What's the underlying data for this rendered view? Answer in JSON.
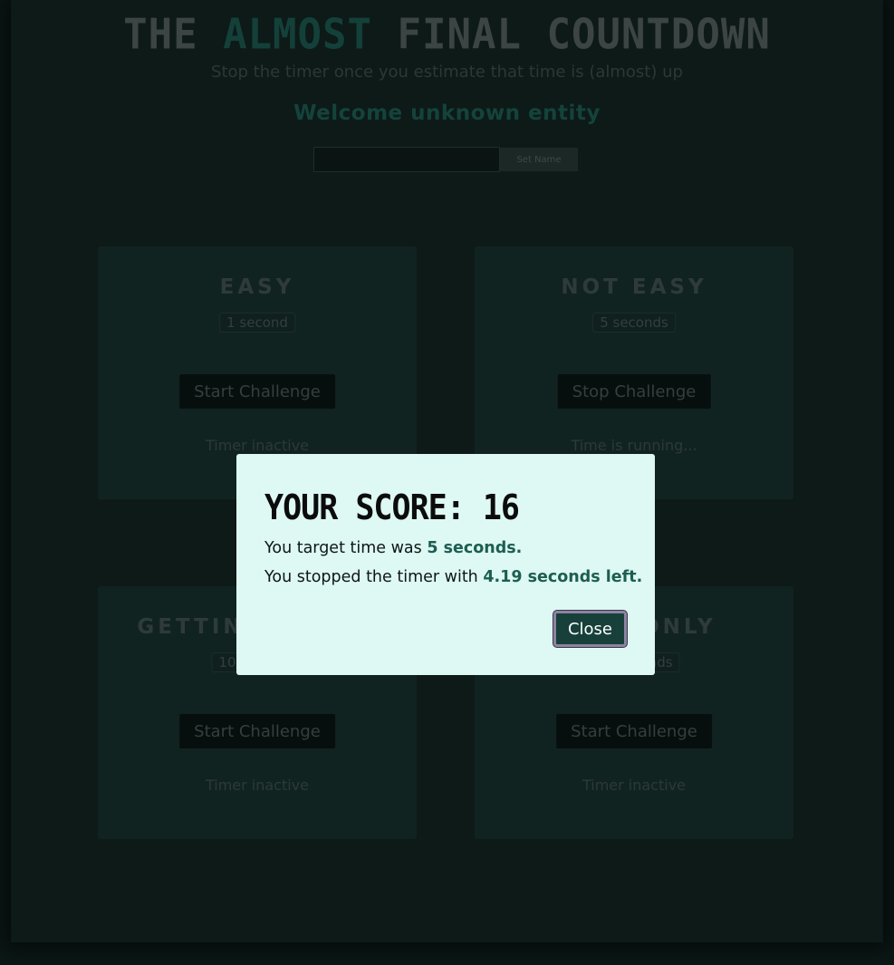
{
  "header": {
    "title_prefix": "THE",
    "title_highlight": "ALMOST",
    "title_suffix": "FINAL COUNTDOWN",
    "subtitle": "Stop the timer once you estimate that time is (almost) up",
    "welcome": "Welcome unknown entity"
  },
  "name_form": {
    "input_value": "",
    "input_placeholder": "",
    "set_button": "Set Name"
  },
  "challenges": [
    {
      "title": "EASY",
      "duration": "1 second",
      "button": "Start Challenge",
      "status": "Timer inactive"
    },
    {
      "title": "NOT EASY",
      "duration": "5 seconds",
      "button": "Stop Challenge",
      "status": "Time is running..."
    },
    {
      "title": "GETTING TOUGH",
      "duration": "10 seconds",
      "button": "Start Challenge",
      "status": "Timer inactive"
    },
    {
      "title": "PROS ONLY",
      "duration": "15 seconds",
      "button": "Start Challenge",
      "status": "Timer inactive"
    }
  ],
  "modal": {
    "title": "YOUR SCORE: 16",
    "target_prefix": "You target time was ",
    "target_value": "5 seconds.",
    "stopped_prefix": "You stopped the timer with ",
    "stopped_value": "4.19 seconds left.",
    "close_button": "Close"
  },
  "colors": {
    "backdrop": "#0b1816",
    "card": "#112321",
    "modal": "#def8f3",
    "accent": "#17403a",
    "highlight_text": "#1d5e52"
  }
}
